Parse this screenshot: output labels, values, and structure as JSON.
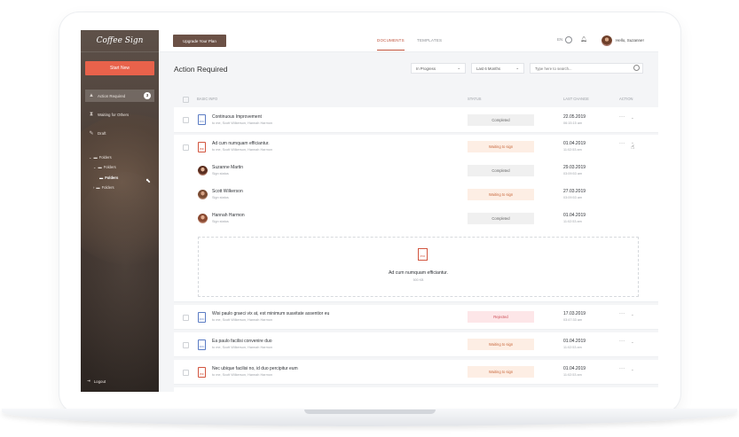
{
  "app": {
    "logo_text": "Coffee Sign",
    "start_button": "Start New",
    "upgrade_button": "Upgrade Your Plan",
    "tabs": [
      {
        "label": "DOCUMENTS",
        "active": true
      },
      {
        "label": "TEMPLATES",
        "active": false
      }
    ],
    "language": "EN",
    "greeting": "Hello, Suzanne!"
  },
  "sidebar": {
    "items": [
      {
        "label": "Action Required",
        "badge": "3",
        "active": true,
        "icon": "warning-icon"
      },
      {
        "label": "Waiting for Others",
        "active": false,
        "icon": "hourglass-icon"
      },
      {
        "label": "Draft",
        "active": false,
        "icon": "pencil-icon"
      }
    ],
    "folders_label": "Folders",
    "folders": [
      {
        "label": "Folders",
        "level": 1
      },
      {
        "label": "Folders",
        "level": 2,
        "selected": true
      },
      {
        "label": "Folders",
        "level": 1
      }
    ],
    "logout": "Logout"
  },
  "main": {
    "title": "Action Required",
    "filter_status": "In Progress",
    "filter_period": "Last 6 Months",
    "search_placeholder": "Type here to search...",
    "columns": [
      "BASIC INFO",
      "STATUS",
      "LAST CHANGE",
      "ACTION"
    ],
    "documents": [
      {
        "title": "Continuous Improvement",
        "meta": "to me, Scott Wilkerson, Hannah Harmon",
        "type": "DOC",
        "status": "Completed",
        "status_kind": "completed",
        "date": "22.05.2019",
        "time": "06:15:15 am"
      },
      {
        "title": "Ad cum numquam efficiantur.",
        "meta": "to me, Scott Wilkerson, Hannah Harmon",
        "type": "PDF",
        "status": "Waiting to sign",
        "status_kind": "waiting",
        "date": "01.04.2019",
        "time": "11:02:53 am"
      }
    ],
    "signers": [
      {
        "name": "Suzanne Martin",
        "meta": "Sign status",
        "status": "Completed",
        "status_kind": "completed",
        "date": "29.03.2019",
        "time": "03:09:53 am"
      },
      {
        "name": "Scott Wilkerson",
        "meta": "Sign status",
        "status": "Waiting to sign",
        "status_kind": "waiting",
        "date": "27.03.2019",
        "time": "03:09:53 am"
      },
      {
        "name": "Hannah Harmon",
        "meta": "Sign status",
        "status": "Completed",
        "status_kind": "completed",
        "date": "01.04.2019",
        "time": "11:02:53 am"
      }
    ],
    "preview": {
      "title": "Ad cum numquam efficiantur.",
      "size": "500 KB",
      "type": "PDF"
    },
    "more_documents": [
      {
        "title": "Wisi paulo graeci vix at, est minimum suavitate assentior eu",
        "meta": "to me, Scott Wilkerson, Hannah Harmon",
        "type": "DOC",
        "status": "Rejected",
        "status_kind": "rejected",
        "date": "17.03.2019",
        "time": "03:47:33 am"
      },
      {
        "title": "Ea paulo facilisi convenire duo",
        "meta": "to me, Scott Wilkerson, Hannah Harmon",
        "type": "DOC",
        "status": "Waiting to sign",
        "status_kind": "waiting",
        "date": "01.04.2019",
        "time": "11:02:53 am"
      },
      {
        "title": "Nec ubique facilisi no, id duo percipitur eum",
        "meta": "to me, Scott Wilkerson, Hannah Harmon",
        "type": "PDF",
        "status": "Waiting to sign",
        "status_kind": "waiting",
        "date": "01.04.2019",
        "time": "11:02:53 am"
      }
    ]
  },
  "colors": {
    "accent": "#e8624b",
    "brand_brown": "#6b5146",
    "waiting": "#fdeee4",
    "rejected": "#fde6e8",
    "completed": "#f0f0f0"
  }
}
